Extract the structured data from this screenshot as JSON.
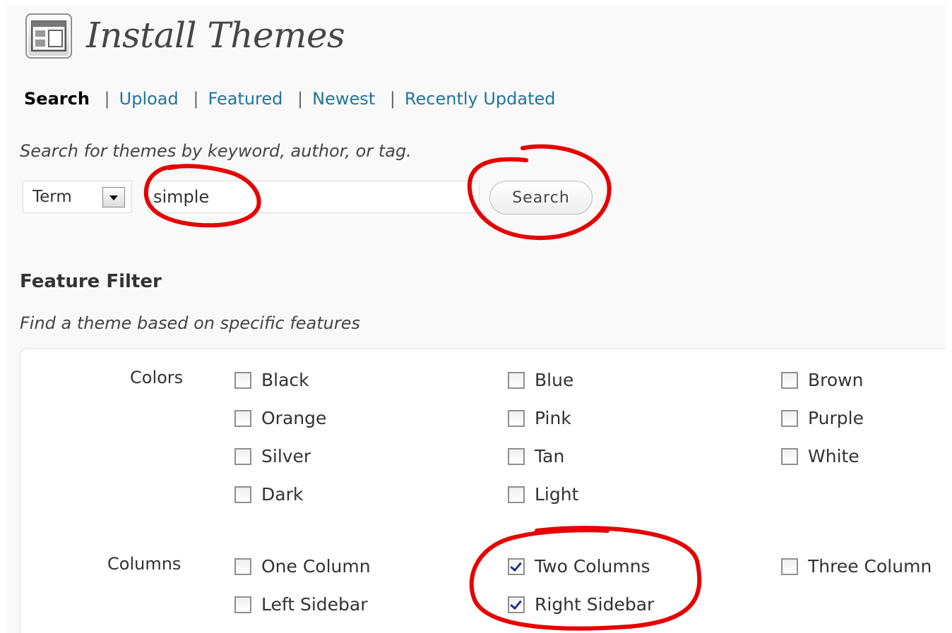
{
  "header": {
    "title": "Install Themes",
    "icon": "theme-layout-icon"
  },
  "tabs": [
    {
      "label": "Search",
      "current": true
    },
    {
      "label": "Upload"
    },
    {
      "label": "Featured"
    },
    {
      "label": "Newest"
    },
    {
      "label": "Recently Updated"
    }
  ],
  "tab_separator": "|",
  "search": {
    "help": "Search for themes by keyword, author, or tag.",
    "type_value": "Term",
    "query": "simple",
    "button": "Search"
  },
  "feature_filter": {
    "title": "Feature Filter",
    "help": "Find a theme based on specific features",
    "groups": [
      {
        "label": "Colors",
        "options": [
          {
            "label": "Black",
            "checked": false
          },
          {
            "label": "Blue",
            "checked": false
          },
          {
            "label": "Brown",
            "checked": false
          },
          {
            "label": "Orange",
            "checked": false
          },
          {
            "label": "Pink",
            "checked": false
          },
          {
            "label": "Purple",
            "checked": false
          },
          {
            "label": "Silver",
            "checked": false
          },
          {
            "label": "Tan",
            "checked": false
          },
          {
            "label": "White",
            "checked": false
          },
          {
            "label": "Dark",
            "checked": false
          },
          {
            "label": "Light",
            "checked": false
          }
        ]
      },
      {
        "label": "Columns",
        "options": [
          {
            "label": "One Column",
            "checked": false
          },
          {
            "label": "Two Columns",
            "checked": true
          },
          {
            "label": "Three Column",
            "checked": false
          },
          {
            "label": "Left Sidebar",
            "checked": false
          },
          {
            "label": "Right Sidebar",
            "checked": true
          }
        ]
      }
    ]
  },
  "colors": {
    "link": "#21759b",
    "annotation": "#e60000",
    "checkmark": "#23358c"
  }
}
